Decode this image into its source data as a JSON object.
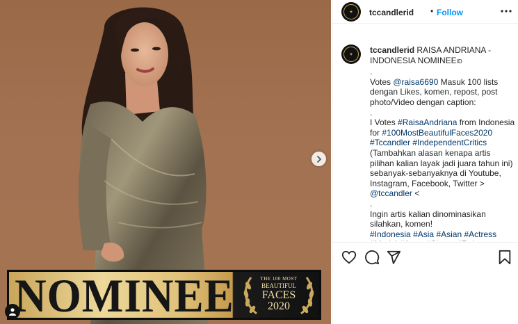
{
  "post": {
    "banner_text": "NOMINEE",
    "badge": {
      "line1": "THE 100 MOST",
      "line2": "BEAUTIFUL",
      "line3": "FACES",
      "line4": "2020"
    }
  },
  "header": {
    "username": "tccandlerid",
    "separator": "•",
    "follow_label": "Follow"
  },
  "caption": {
    "username": "tccandlerid",
    "lines": [
      {
        "parts": [
          {
            "t": "RAISA ANDRIANA -"
          }
        ]
      },
      {
        "parts": [
          {
            "t": "INDONESIA NOMINEE"
          },
          {
            "t": "ID",
            "small": true
          }
        ]
      },
      {
        "parts": [
          {
            "t": "."
          }
        ]
      },
      {
        "parts": [
          {
            "t": "Votes "
          },
          {
            "t": "@raisa6690",
            "link": true
          },
          {
            "t": " Masuk 100 lists"
          }
        ]
      },
      {
        "parts": [
          {
            "t": "dengan Likes, komen, repost, post"
          }
        ]
      },
      {
        "parts": [
          {
            "t": "photo/Video dengan caption:"
          }
        ]
      },
      {
        "parts": [
          {
            "t": "."
          }
        ]
      },
      {
        "parts": [
          {
            "t": "I Votes "
          },
          {
            "t": "#RaisaAndriana",
            "link": true
          },
          {
            "t": " from Indonesia"
          }
        ]
      },
      {
        "parts": [
          {
            "t": "for "
          },
          {
            "t": "#100MostBeautifulFaces2020",
            "link": true
          }
        ]
      },
      {
        "parts": [
          {
            "t": "#Tccandler",
            "link": true
          },
          {
            "t": " "
          },
          {
            "t": "#IndependentCritics",
            "link": true
          }
        ]
      },
      {
        "parts": [
          {
            "t": "(Tambahkan alasan kenapa artis"
          }
        ]
      },
      {
        "parts": [
          {
            "t": "pilihan kalian layak jadi juara tahun ini)"
          }
        ]
      },
      {
        "parts": [
          {
            "t": "sebanyak-sebanyaknya di Youtube,"
          }
        ]
      },
      {
        "parts": [
          {
            "t": "Instagram, Facebook, Twitter >"
          }
        ]
      },
      {
        "parts": [
          {
            "t": "@tccandler",
            "link": true
          },
          {
            "t": " <"
          }
        ]
      },
      {
        "parts": [
          {
            "t": "."
          }
        ]
      },
      {
        "parts": [
          {
            "t": "Ingin artis kalian dinominasikan"
          }
        ]
      },
      {
        "parts": [
          {
            "t": "silahkan, komen!"
          }
        ]
      },
      {
        "parts": [
          {
            "t": "#Indonesia",
            "link": true
          },
          {
            "t": " "
          },
          {
            "t": "#Asia",
            "link": true
          },
          {
            "t": " "
          },
          {
            "t": "#Asian",
            "link": true
          },
          {
            "t": " "
          },
          {
            "t": "#Actress",
            "link": true
          }
        ]
      },
      {
        "parts": [
          {
            "t": "#Model",
            "link": true
          },
          {
            "t": " "
          },
          {
            "t": "#Actor",
            "link": true
          },
          {
            "t": " "
          },
          {
            "t": "#Singer",
            "link": true
          },
          {
            "t": " "
          },
          {
            "t": "#Raisa",
            "link": true
          }
        ]
      }
    ]
  },
  "icons": {
    "more": "more-horizontal-icon",
    "next": "chevron-right-icon",
    "user_tag": "user-tag-icon",
    "like": "heart-icon",
    "comment": "comment-icon",
    "share": "share-icon",
    "save": "bookmark-icon"
  },
  "colors": {
    "link": "#00376b",
    "follow": "#0095f6",
    "gold": "#c8a55a"
  }
}
